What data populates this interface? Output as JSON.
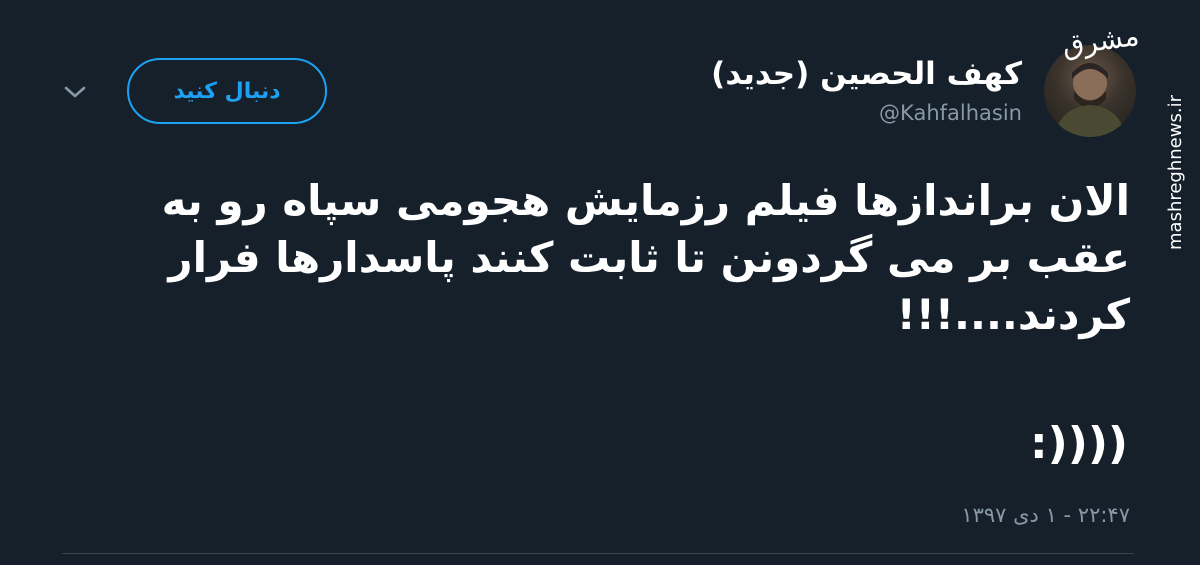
{
  "tweet": {
    "display_name": "کهف الحصین (جدید)",
    "handle": "@Kahfalhasin",
    "follow_label": "دنبال کنید",
    "text": "الان براندازها فیلم رزمایش هجومی سپاه رو به عقب بر می گردونن تا ثابت کنند پاسدارها فرار کردند....!!!",
    "emoji_line": ":))))",
    "timestamp": "۲۲:۴۷ - ۱ دی ۱۳۹۷"
  },
  "icons": {
    "caret": "chevron-down-icon",
    "avatar": "profile-photo"
  },
  "watermark": {
    "logo": "مشرق",
    "site": "mashreghnews.ir"
  },
  "colors": {
    "background": "#15202b",
    "accent": "#1da1f2",
    "muted": "#8899a6",
    "divider": "#38444d"
  }
}
